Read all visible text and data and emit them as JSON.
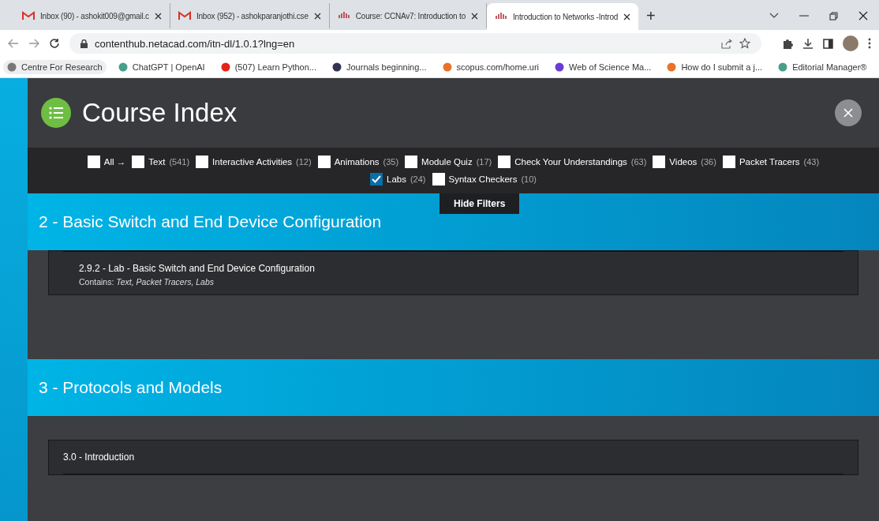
{
  "browser": {
    "tabs": [
      {
        "title": "Inbox (90) - ashokit009@gmail.c",
        "kind": "mail",
        "selected": false
      },
      {
        "title": "Inbox (952) - ashokparanjothi.cse",
        "kind": "mail",
        "selected": false
      },
      {
        "title": "Course: CCNAv7: Introduction to",
        "kind": "site",
        "selected": false
      },
      {
        "title": "Introduction to Networks -Introd",
        "kind": "site",
        "selected": true
      }
    ],
    "new_tab": "+",
    "url": "contenthub.netacad.com/itn-dl/1.0.1?lng=en",
    "bookmarks": [
      {
        "label": "Centre For Research",
        "selected": true
      },
      {
        "label": "ChatGPT | OpenAI",
        "selected": false
      },
      {
        "label": "(507) Learn Python...",
        "selected": false
      },
      {
        "label": "Journals beginning...",
        "selected": false
      },
      {
        "label": "scopus.com/home.uri",
        "selected": false
      },
      {
        "label": "Web of Science Ma...",
        "selected": false
      },
      {
        "label": "How do I submit a j...",
        "selected": false
      },
      {
        "label": "Editorial Manager®",
        "selected": false
      }
    ]
  },
  "course_index": {
    "title": "Course Index",
    "filter_rows": [
      [
        {
          "label": "All →",
          "checked": false
        },
        {
          "label": "Text",
          "count": "(541)",
          "checked": false
        },
        {
          "label": "Interactive Activities",
          "count": "(12)",
          "checked": false
        },
        {
          "label": "Animations",
          "count": "(35)",
          "checked": false
        },
        {
          "label": "Module Quiz",
          "count": "(17)",
          "checked": false
        },
        {
          "label": "Check Your Understandings",
          "count": "(63)",
          "checked": false
        },
        {
          "label": "Videos",
          "count": "(36)",
          "checked": false
        },
        {
          "label": "Packet Tracers",
          "count": "(43)",
          "checked": false
        }
      ],
      [
        {
          "label": "Labs",
          "count": "(24)",
          "checked": true
        },
        {
          "label": "Syntax Checkers",
          "count": "(10)",
          "checked": false
        }
      ]
    ],
    "hide_filters": "Hide Filters",
    "sections": [
      {
        "title": "2 - Basic Switch and End Device Configuration",
        "items": [
          {
            "title": "2.9.2 - Lab - Basic Switch and End Device Configuration",
            "contains": "Contains: *Text, Packet Tracers, Labs*"
          }
        ]
      },
      {
        "title": "3 - Protocols and Models",
        "items": [
          {
            "title": "3.0 - Introduction"
          }
        ]
      }
    ]
  }
}
